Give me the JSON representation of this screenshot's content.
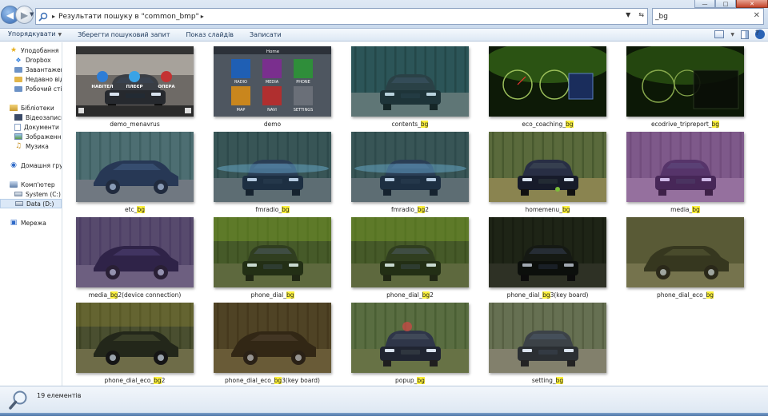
{
  "address": {
    "path_text": "Результати пошуку в \"common_bmp\"",
    "search_value": "_bg"
  },
  "commands": {
    "organize": "Упорядкувати",
    "save_search": "Зберегти пошуковий запит",
    "slideshow": "Показ слайдів",
    "burn": "Записати"
  },
  "nav": {
    "favorites": {
      "label": "Уподобання",
      "items": [
        "Dropbox",
        "Завантаження",
        "Недавно відві",
        "Робочий стіл"
      ]
    },
    "libraries": {
      "label": "Бібліотеки",
      "items": [
        "Відеозаписи",
        "Документи",
        "Зображення",
        "Музика"
      ]
    },
    "homegroup": "Домашня група",
    "computer": {
      "label": "Комп'ютер",
      "items": [
        "System (C:)",
        "Data (D:)"
      ]
    },
    "network": "Мережа"
  },
  "files": [
    {
      "pre": "demo_menavrus",
      "hl": "",
      "post": "",
      "art": "menu3"
    },
    {
      "pre": "demo",
      "hl": "",
      "post": "",
      "art": "grid"
    },
    {
      "pre": "contents_",
      "hl": "bg",
      "post": "",
      "art": "car_teal"
    },
    {
      "pre": "eco_coaching_",
      "hl": "bg",
      "post": "",
      "art": "gauges"
    },
    {
      "pre": "ecodrive_tripreport_",
      "hl": "bg",
      "post": "",
      "art": "gauges2"
    },
    {
      "pre": "etc_",
      "hl": "bg",
      "post": "",
      "art": "car_side_blue"
    },
    {
      "pre": "fmradio_",
      "hl": "bg",
      "post": "",
      "art": "car_front_blue"
    },
    {
      "pre": "fmradio_",
      "hl": "bg",
      "post": "2",
      "art": "car_front_blue"
    },
    {
      "pre": "homemenu_",
      "hl": "bg",
      "post": "",
      "art": "car_forest"
    },
    {
      "pre": "media_",
      "hl": "bg",
      "post": "",
      "art": "car_purple"
    },
    {
      "pre": "media_",
      "hl": "bg",
      "post": "2(device connection)",
      "art": "car_side_purple"
    },
    {
      "pre": "phone_dial_",
      "hl": "bg",
      "post": "",
      "art": "car_green_road"
    },
    {
      "pre": "phone_dial_",
      "hl": "bg",
      "post": "2",
      "art": "car_green_road"
    },
    {
      "pre": "phone_dial_",
      "hl": "bg",
      "post": "3(key board)",
      "art": "car_dark_road"
    },
    {
      "pre": "phone_dial_eco_",
      "hl": "bg",
      "post": "",
      "art": "car_side_olive"
    },
    {
      "pre": "phone_dial_eco_",
      "hl": "bg",
      "post": "2",
      "art": "car_side_olive2"
    },
    {
      "pre": "phone_dial_eco_",
      "hl": "bg",
      "post": "3(key board)",
      "art": "car_side_olive3"
    },
    {
      "pre": "popup_",
      "hl": "bg",
      "post": "",
      "art": "car_popup"
    },
    {
      "pre": "setting_",
      "hl": "bg",
      "post": "",
      "art": "car_setting"
    }
  ],
  "menu_labels": {
    "navitel": "НАВІТЕЛ",
    "player": "ПЛЕЄР",
    "opera": "ОПЕРА",
    "home": "Home",
    "radio": "RADIO",
    "media": "MEDIA",
    "phone": "PHONE",
    "map": "MAP",
    "navi": "NAVI",
    "settings": "SETTINGS"
  },
  "status": {
    "count": "19 елементів"
  }
}
